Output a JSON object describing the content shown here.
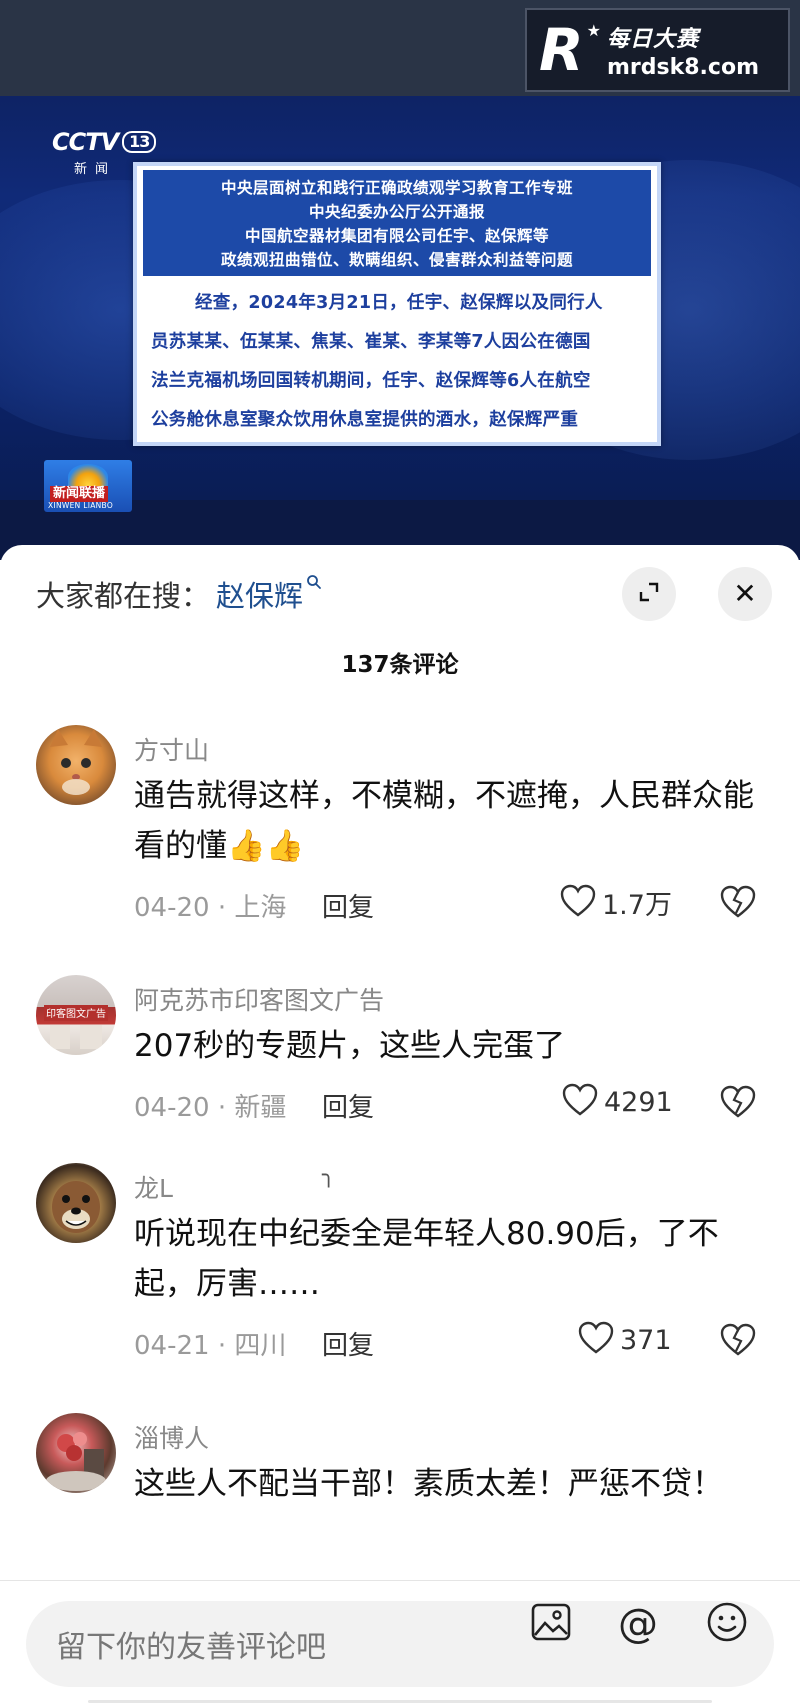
{
  "watermark": {
    "logo_letter": "R",
    "cn": "每日大赛",
    "url": "mrdsk8.com"
  },
  "video": {
    "channel_logo": "CCTV",
    "channel_number": "13",
    "channel_sub": "新闻",
    "notice_header": [
      "中央层面树立和践行正确政绩观学习教育工作专班",
      "中央纪委办公厅公开通报",
      "中国航空器材集团有限公司任宇、赵保辉等",
      "政绩观扭曲错位、欺瞒组织、侵害群众利益等问题"
    ],
    "notice_body": [
      "经查，2024年3月21日，任宇、赵保辉以及同行人",
      "员苏某某、伍某某、焦某、崔某、李某等7人因公在德国",
      "法兰克福机场回国转机期间，任宇、赵保辉等6人在航空",
      "公务舱休息室聚众饮用休息室提供的酒水，赵保辉严重"
    ],
    "program_logo_cn": "新闻联播",
    "program_logo_py": "XINWEN LIANBO"
  },
  "sheet": {
    "search_label": "大家都在搜：",
    "search_term": "赵保辉",
    "comment_count": "137条评论",
    "reply_label": "回复",
    "comments": [
      {
        "user": "方寸山",
        "text": "通告就得这样，不模糊，不遮掩，人民群众能看的懂👍👍",
        "date": "04-20 · 上海",
        "likes": "1.7万"
      },
      {
        "user": "阿克苏市印客图文广告",
        "text": "207秒的专题片，这些人完蛋了",
        "date": "04-20 · 新疆",
        "likes": "4291"
      },
      {
        "user": "龙L",
        "text": "听说现在中纪委全是年轻人80.90后，了不起，厉害……",
        "date": "04-21 · 四川",
        "likes": "371"
      },
      {
        "user": "淄博人",
        "text": "这些人不配当干部！素质太差！严惩不贷！",
        "date": "",
        "likes": ""
      }
    ],
    "avatar_shop_sign": "印客图文广告"
  },
  "input": {
    "placeholder": "留下你的友善评论吧"
  },
  "icons": {
    "expand": "expand-icon",
    "close": "close-icon",
    "search": "search-icon",
    "like": "heart-icon",
    "dislike": "broken-heart-icon",
    "image": "image-icon",
    "mention": "at-icon",
    "emoji": "emoji-icon"
  },
  "colors": {
    "search_term": "#1f4f8f",
    "notice_blue": "#1d4aa8",
    "notice_text": "#1d3f9e"
  }
}
